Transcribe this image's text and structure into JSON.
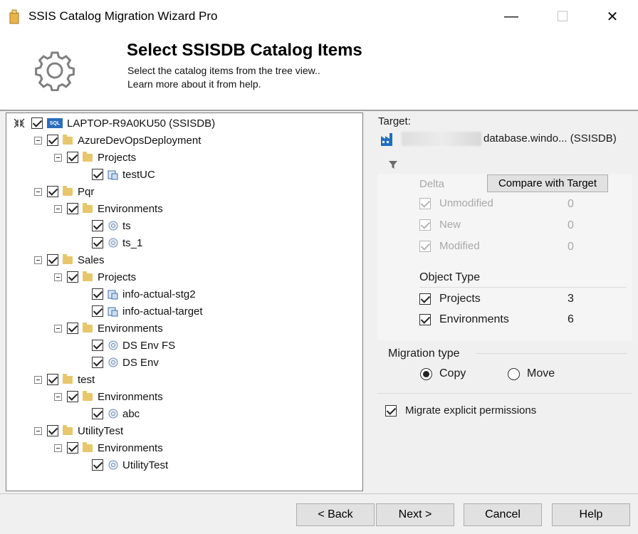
{
  "window": {
    "title": "SSIS Catalog Migration Wizard Pro",
    "minimize": "—",
    "maximize": "☐",
    "close": "✕"
  },
  "header": {
    "title": "Select SSISDB Catalog Items",
    "subtitle1": "Select the catalog items from the tree view..",
    "subtitle2": "Learn more about it from help."
  },
  "tree": {
    "root": "LAPTOP-R9A0KU50 (SSISDB)",
    "nodes": [
      {
        "label": "AzureDevOpsDeployment"
      },
      {
        "label": "Projects"
      },
      {
        "label": "testUC"
      },
      {
        "label": "Pqr"
      },
      {
        "label": "Environments"
      },
      {
        "label": "ts"
      },
      {
        "label": "ts_1"
      },
      {
        "label": "Sales"
      },
      {
        "label": "Projects"
      },
      {
        "label": "info-actual-stg2"
      },
      {
        "label": "info-actual-target"
      },
      {
        "label": "Environments"
      },
      {
        "label": "DS Env FS"
      },
      {
        "label": "DS Env"
      },
      {
        "label": "test"
      },
      {
        "label": "Environments"
      },
      {
        "label": "abc"
      },
      {
        "label": "UtilityTest"
      },
      {
        "label": "Environments"
      },
      {
        "label": "UtilityTest"
      }
    ]
  },
  "target": {
    "label": "Target:",
    "value": "database.windo... (SSISDB)"
  },
  "delta": {
    "label": "Delta",
    "compare_button": "Compare with Target",
    "items": [
      {
        "label": "Unmodified",
        "count": "0"
      },
      {
        "label": "New",
        "count": "0"
      },
      {
        "label": "Modified",
        "count": "0"
      }
    ]
  },
  "object_type": {
    "label": "Object Type",
    "items": [
      {
        "label": "Projects",
        "count": "3"
      },
      {
        "label": "Environments",
        "count": "6"
      }
    ]
  },
  "migration": {
    "label": "Migration type",
    "copy": "Copy",
    "move": "Move",
    "selected": "Copy"
  },
  "permissions": {
    "label": "Migrate explicit permissions"
  },
  "buttons": {
    "back": "< Back",
    "next": "Next >",
    "cancel": "Cancel",
    "help": "Help"
  },
  "colors": {
    "server_icon": "#2a6ebd",
    "folder": "#e8c66a",
    "disabled_text": "#a8a8a8"
  }
}
